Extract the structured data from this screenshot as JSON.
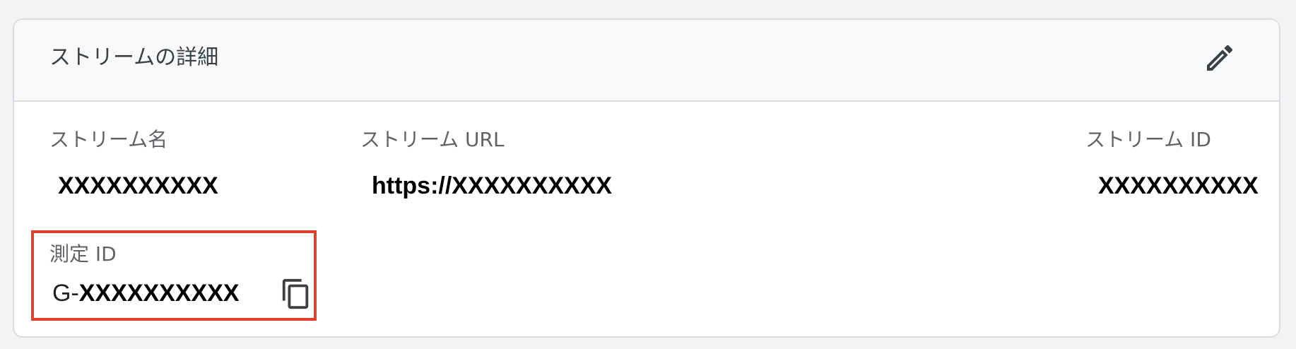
{
  "header": {
    "title": "ストリームの詳細",
    "edit_icon": "pencil-icon"
  },
  "fields": {
    "stream_name": {
      "label": "ストリーム名",
      "value": "XXXXXXXXXX"
    },
    "stream_url": {
      "label": "ストリーム URL",
      "value": "https://XXXXXXXXXX"
    },
    "stream_id": {
      "label": "ストリーム ID",
      "value": "XXXXXXXXXX"
    }
  },
  "measurement": {
    "label": "測定 ID",
    "prefix": "G-",
    "value": "XXXXXXXXXX",
    "copy_icon": "copy-icon",
    "highlight_color": "#e2402a"
  }
}
